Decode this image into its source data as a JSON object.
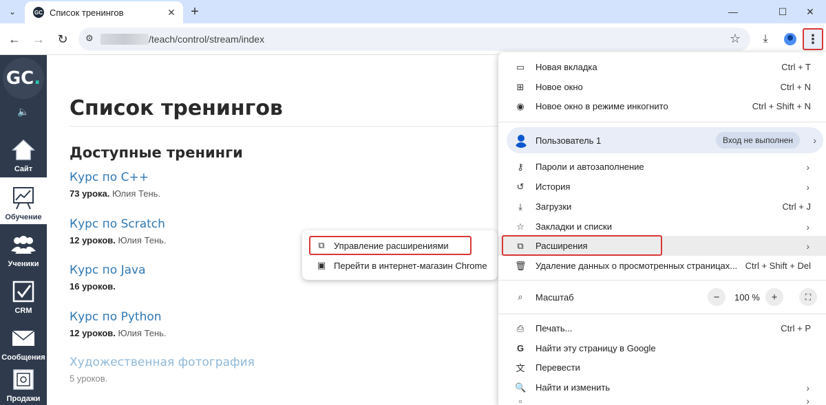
{
  "browser": {
    "tab_title": "Список тренингов",
    "favicon_text": "GC",
    "url_path": "/teach/control/stream/index",
    "new_tab": "+",
    "tab_close": "✕"
  },
  "sidebar": {
    "logo_main": "GC",
    "logo_dot": ".",
    "items": [
      {
        "label": "Сайт",
        "icon": "home-icon"
      },
      {
        "label": "Обучение",
        "icon": "chart-board-icon"
      },
      {
        "label": "Ученики",
        "icon": "users-icon"
      },
      {
        "label": "CRM",
        "icon": "checkbox-icon"
      },
      {
        "label": "Сообщения",
        "icon": "envelope-icon"
      },
      {
        "label": "Продажи",
        "icon": "safe-icon"
      }
    ]
  },
  "page": {
    "title": "Список тренингов",
    "section_title": "Доступные тренинги",
    "courses": [
      {
        "name": "Курс по С++",
        "meta_bold": "73 урока.",
        "meta_rest": " Юлия Тень."
      },
      {
        "name": "Курс по Scratch",
        "meta_bold": "12 уроков.",
        "meta_rest": " Юлия Тень."
      },
      {
        "name": "Курс по Java",
        "meta_bold": "16 уроков.",
        "meta_rest": ""
      },
      {
        "name": "Курс по Python",
        "meta_bold": "12 уроков.",
        "meta_rest": " Юлия Тень."
      },
      {
        "name": "Художественная фотография",
        "meta_bold": "",
        "meta_rest": "5 уроков."
      }
    ]
  },
  "submenu": {
    "items": [
      {
        "label": "Управление расширениями",
        "icon": "puzzle-icon"
      },
      {
        "label": "Перейти в интернет-магазин Chrome",
        "icon": "store-icon"
      }
    ]
  },
  "menu": {
    "new_tab": {
      "label": "Новая вкладка",
      "shortcut": "Ctrl + T"
    },
    "new_window": {
      "label": "Новое окно",
      "shortcut": "Ctrl + N"
    },
    "incognito": {
      "label": "Новое окно в режиме инкогнито",
      "shortcut": "Ctrl + Shift + N"
    },
    "profile": {
      "label": "Пользователь 1",
      "status": "Вход не выполнен"
    },
    "passwords": {
      "label": "Пароли и автозаполнение"
    },
    "history": {
      "label": "История"
    },
    "downloads": {
      "label": "Загрузки",
      "shortcut": "Ctrl + J"
    },
    "bookmarks": {
      "label": "Закладки и списки"
    },
    "extensions": {
      "label": "Расширения"
    },
    "clear_data": {
      "label": "Удаление данных о просмотренных страницах...",
      "shortcut": "Ctrl + Shift + Del"
    },
    "zoom": {
      "label": "Масштаб",
      "value": "100 %",
      "minus": "−",
      "plus": "+"
    },
    "print": {
      "label": "Печать...",
      "shortcut": "Ctrl + P"
    },
    "google_search": {
      "label": "Найти эту страницу в Google"
    },
    "translate": {
      "label": "Перевести"
    },
    "find_edit": {
      "label": "Найти и изменить"
    }
  }
}
